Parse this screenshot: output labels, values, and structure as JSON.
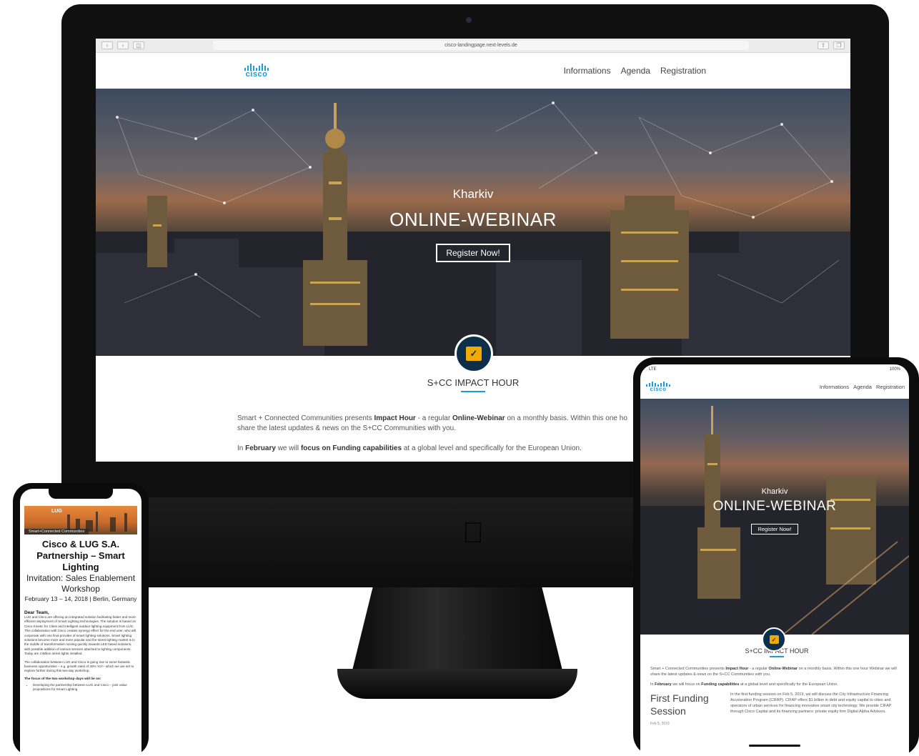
{
  "browser": {
    "url": "cisco-landingpage.next-levels.de"
  },
  "site": {
    "logo_text": "cisco",
    "nav": [
      "Informations",
      "Agenda",
      "Registration"
    ],
    "hero": {
      "city": "Kharkiv",
      "title": "ONLINE-WEBINAR",
      "cta": "Register Now!"
    },
    "section_title": "S+CC IMPACT HOUR",
    "intro": {
      "p1_a": "Smart + Connected Communities presents ",
      "p1_b": "Impact Hour",
      "p1_c": " - a regular ",
      "p1_d": "Online-Webinar",
      "p1_e": " on a monthly basis. Within this one ho",
      "p1_f": "share the latest updates & news on the S+CC Communities with you.",
      "p2_a": "In ",
      "p2_b": "February",
      "p2_c": " we will ",
      "p2_d": "focus on Funding capabilities",
      "p2_e": " at a global level and specifically for the European Union."
    }
  },
  "ipad": {
    "status_left": "LTE",
    "status_right": "100%",
    "intro_p1_a": "Smart + Connected Communities presents ",
    "intro_p1_b": "Impact Hour",
    "intro_p1_c": " - a regular ",
    "intro_p1_d": "Online-Webinar",
    "intro_p1_e": " on a monthly basis. Within this one hour Webinar we will share the latest updates & news on the S+CC Communities with you.",
    "intro_p2_a": "In ",
    "intro_p2_b": "February",
    "intro_p2_c": " we will focus on ",
    "intro_p2_d": "Funding capabilities",
    "intro_p2_e": " at a global level and specifically for the European Union.",
    "funding_title": "First Funding Session",
    "funding_date": "Feb 5, 2019",
    "funding_text": "In the first funding session on Feb 5, 2019, we will discuss the City Infrastructure Financing Acceleration Program (CIFAP). CIFAP offers $1 billion in debt and equity capital to cities and operators of urban services for financing innovative smart city technology. We provide CIFAP through Cisco Capital and its financing partners: private equity firm Digital Alpha Advisors."
  },
  "iphone": {
    "banner_tag": "Smart+Connected Communities",
    "banner_logo": "LUG",
    "title": "Cisco & LUG S.A. Partnership – Smart Lighting",
    "subtitle": "Invitation: Sales Enablement Workshop",
    "date": "February 13 – 14, 2018 | Berlin, Germany",
    "greeting": "Dear Team,",
    "p1": "LUG and Cisco are offering an integrated solution facilitating faster and more efficient deployment of Smart Lighting technologies. The solution is based on Cisco Kinetic for Cities and intelligent outdoor lighting equipment from LUG. This collaboration with Cisco creates synergy effect for the end user, who will cooperate with one final provider of smart lighting solutions. Smart lighting solutions become more and more popular and the street lighting market is in the middle of transformation moving quickly towards LED based solutions, with possible addition of various sensors attached to lighting components. Today are 4 Billion street lights installed.",
    "p2": "The collaboration between LUG and Cisco is going rise to some fantastic business opportunities – e.g. growth rates of 30% YoY– which we are set to explore further during this two-day workshop.",
    "focus_heading": "The focus of the two workshop days will lie on:",
    "bullet1": "Developing the partnership between LUG and Cisco – joint value propositions for Smart Lighting"
  }
}
